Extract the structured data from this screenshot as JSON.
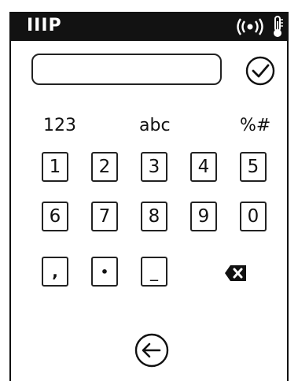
{
  "statusbar": {
    "title": "IIIP",
    "icons": [
      "wireless-signal-icon",
      "thermometer-icon"
    ]
  },
  "input": {
    "value": "",
    "confirm_icon": "check-circle-icon"
  },
  "tabs": [
    "123",
    "abc",
    "%#"
  ],
  "keypad": {
    "row1": [
      "1",
      "2",
      "3",
      "4",
      "5"
    ],
    "row2": [
      "6",
      "7",
      "8",
      "9",
      "0"
    ],
    "row3": [
      ",",
      "•",
      "_"
    ],
    "backspace_icon": "backspace-icon"
  },
  "back_icon": "back-arrow-icon"
}
